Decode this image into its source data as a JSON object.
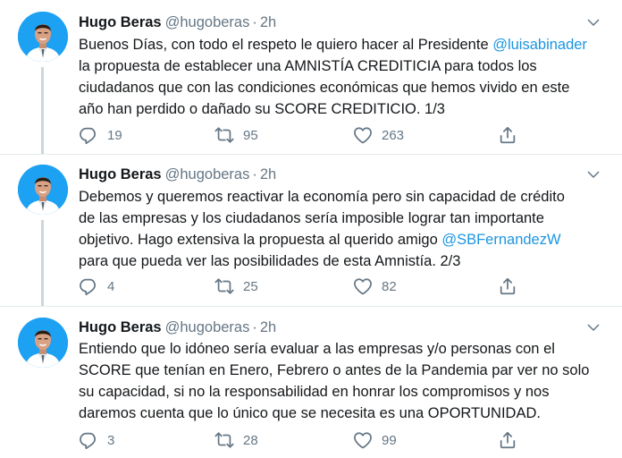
{
  "tweets": [
    {
      "name": "Hugo Beras",
      "handle": "@hugoberas",
      "dot": "·",
      "time": "2h",
      "text_before": "Buenos Días, con todo el respeto le quiero hacer al Presidente ",
      "mention": "@luisabinader",
      "text_after": "\nla propuesta de establecer una AMNISTÍA CREDITICIA para todos los\nciudadanos que con las condiciones económicas que hemos vivido en este\naño han perdido o dañado su SCORE CREDITICIO. 1/3",
      "replies": "19",
      "retweets": "95",
      "likes": "263"
    },
    {
      "name": "Hugo Beras",
      "handle": "@hugoberas",
      "dot": "·",
      "time": "2h",
      "text_before": "Debemos y queremos reactivar la economía pero sin capacidad de crédito\nde las empresas y los ciudadanos sería imposible lograr tan importante\nobjetivo. Hago extensiva la propuesta al querido amigo ",
      "mention": "@SBFernandezW",
      "text_after": "\npara que pueda ver las posibilidades de esta Amnistía. 2/3",
      "replies": "4",
      "retweets": "25",
      "likes": "82"
    },
    {
      "name": "Hugo Beras",
      "handle": "@hugoberas",
      "dot": "·",
      "time": "2h",
      "text_before": "Entiendo que lo idóneo sería evaluar a las empresas y/o personas con el\nSCORE que tenían en Enero, Febrero o antes de la Pandemia par ver no solo\nsu capacidad, si no la responsabilidad en honrar los compromisos y nos\ndaremos cuenta que lo único que se necesita es una OPORTUNIDAD.",
      "mention": "",
      "text_after": "",
      "replies": "3",
      "retweets": "28",
      "likes": "99"
    }
  ],
  "icons": {
    "reply": "reply-icon",
    "retweet": "retweet-icon",
    "like": "heart-icon",
    "share": "share-icon",
    "menu": "chevron-down-icon"
  },
  "colors": {
    "text": "#14171a",
    "muted": "#657786",
    "link": "#1b95e0",
    "avatar_bg": "#1da1f2",
    "thread_line": "#ccd6dd"
  }
}
